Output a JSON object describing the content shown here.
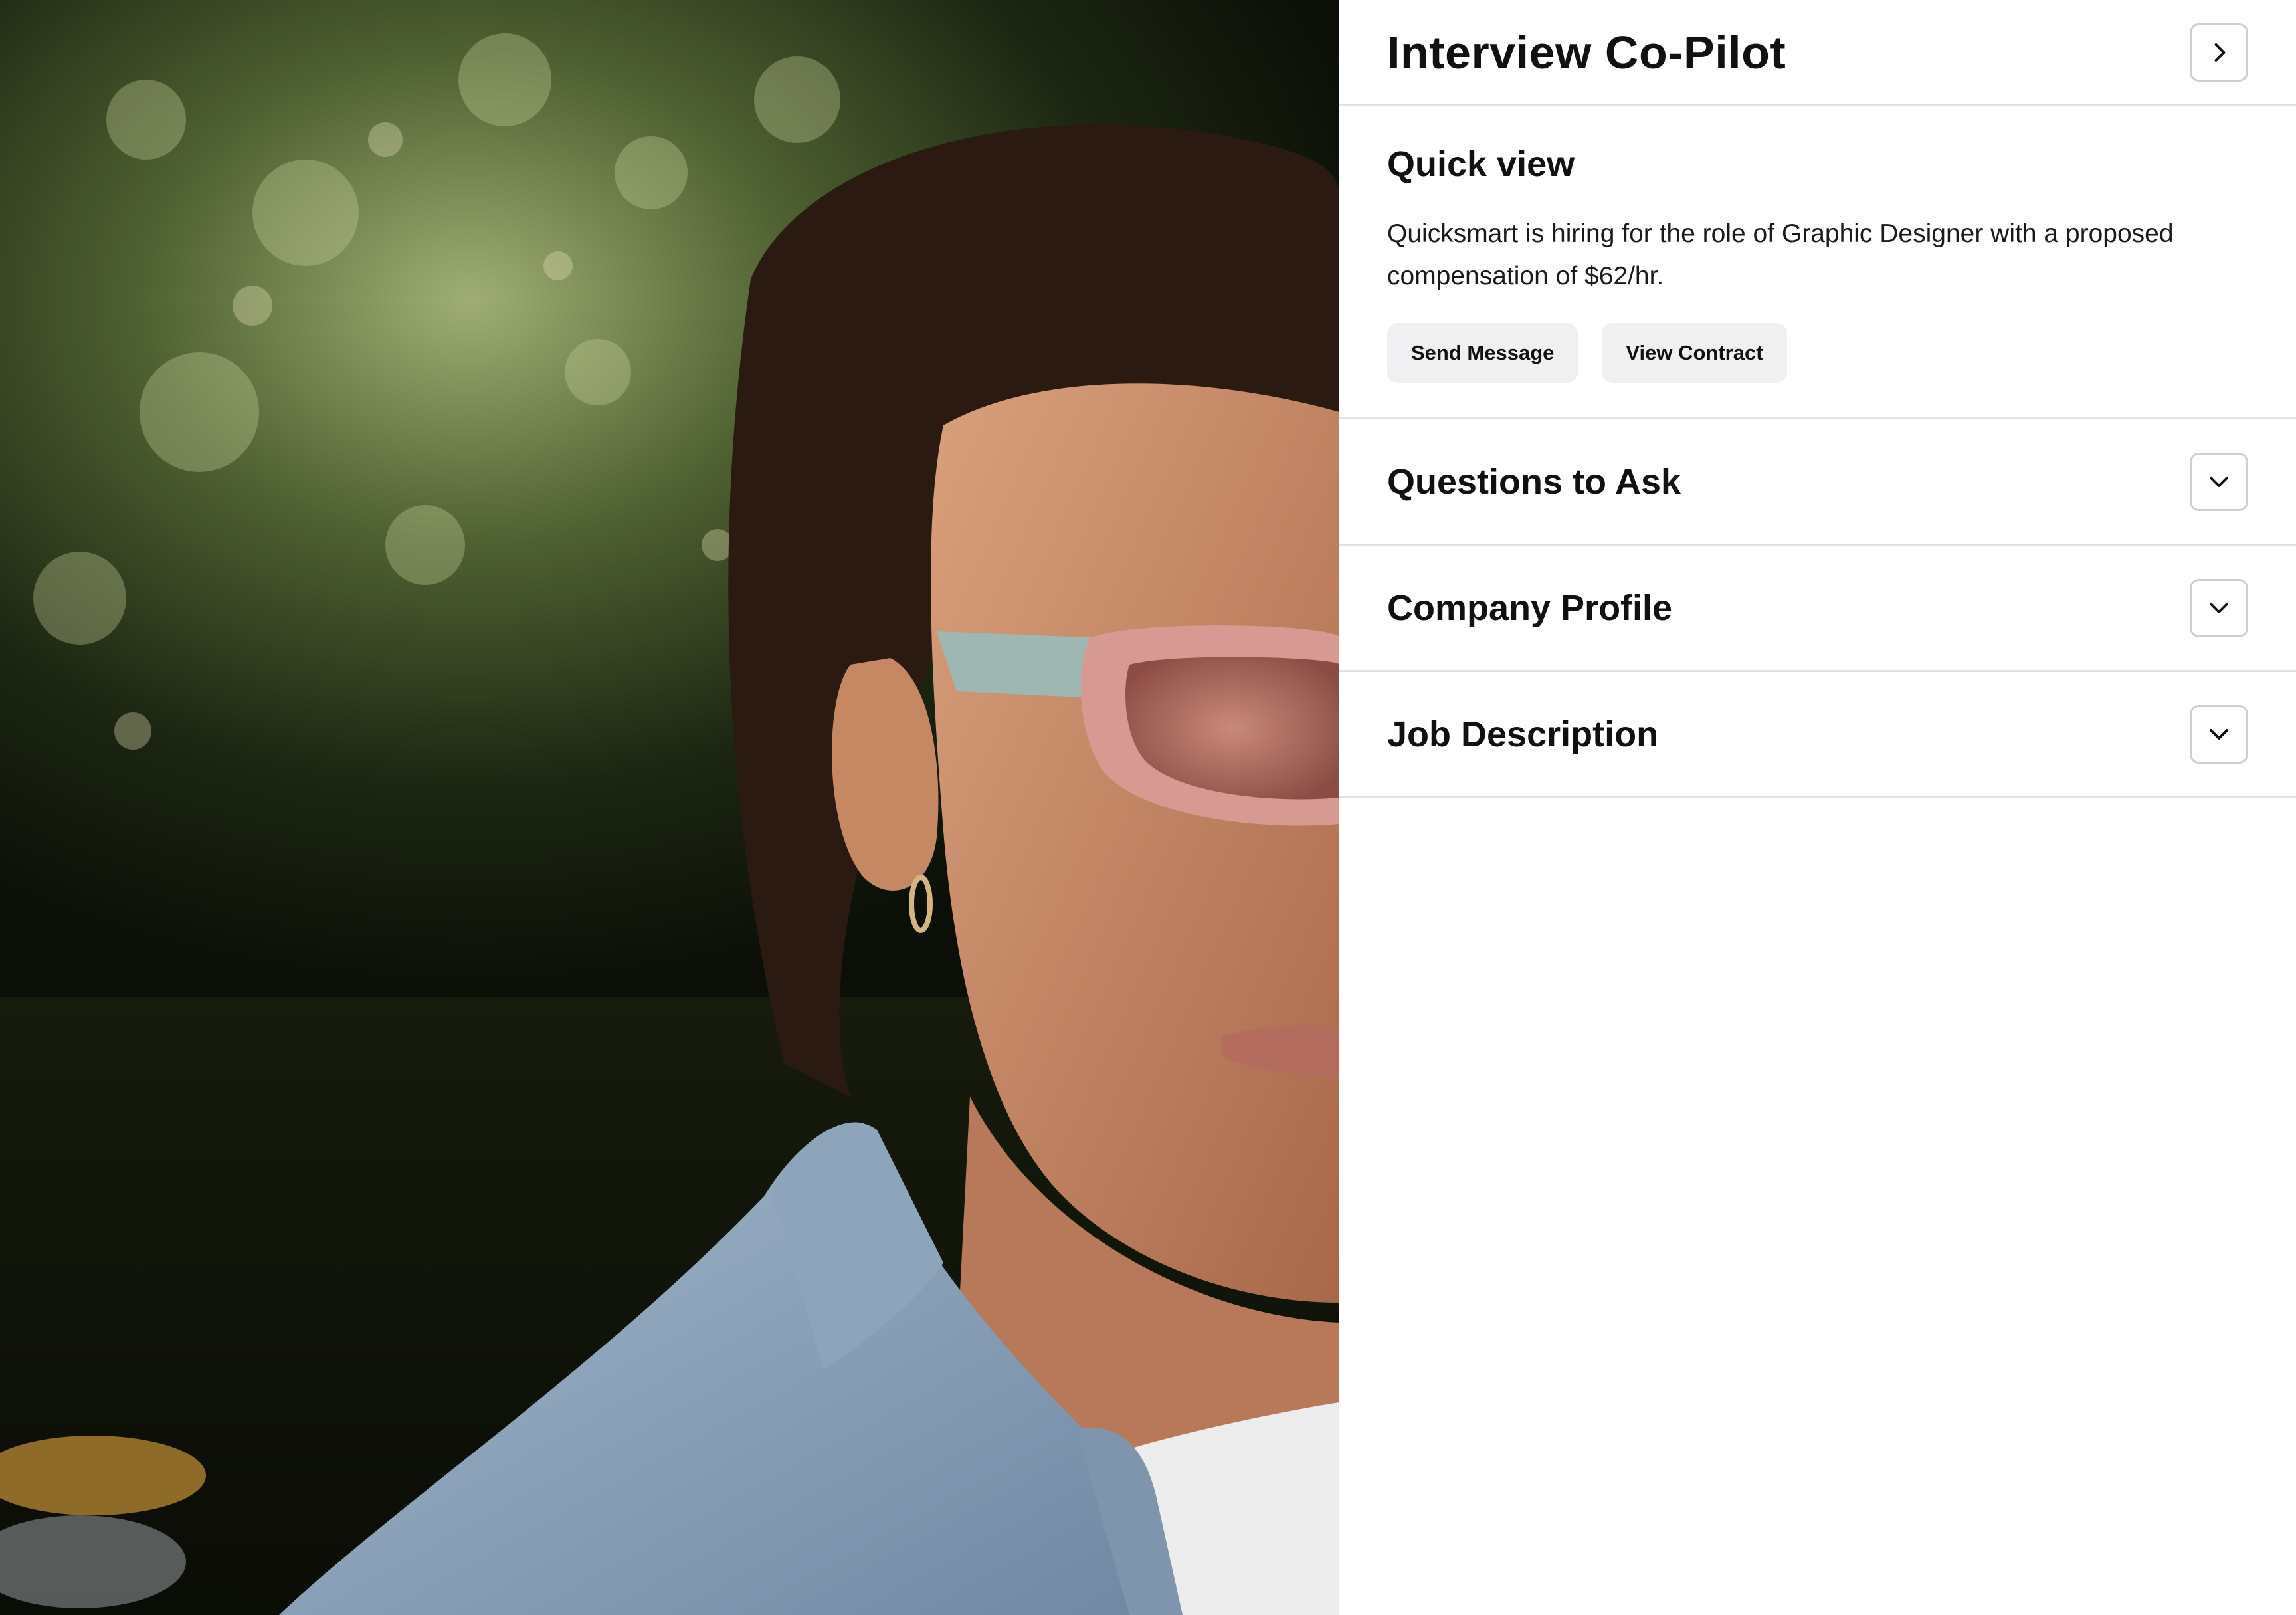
{
  "photo": {
    "description_icon": "portrait-photo"
  },
  "panel": {
    "title": "Interview Co-Pilot",
    "collapse_icon": "chevron-right-icon"
  },
  "quick_view": {
    "heading": "Quick view",
    "text": "Quicksmart is hiring for the role of Graphic Designer with a proposed compensation of $62/hr.",
    "actions": [
      {
        "label": "Send Message"
      },
      {
        "label": "View Contract"
      }
    ]
  },
  "sections": [
    {
      "title": "Questions to Ask",
      "icon": "chevron-down-icon"
    },
    {
      "title": "Company Profile",
      "icon": "chevron-down-icon"
    },
    {
      "title": "Job Description",
      "icon": "chevron-down-icon"
    }
  ],
  "colors": {
    "panel_bg": "#ffffff",
    "divider": "#e2e2e4",
    "button_bg": "#f0f0f3",
    "text": "#111111"
  }
}
